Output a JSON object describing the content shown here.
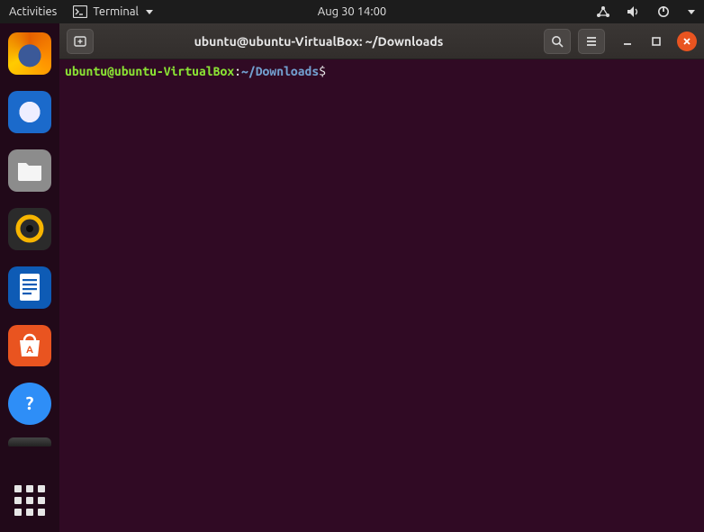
{
  "topbar": {
    "activities": "Activities",
    "app_label": "Terminal",
    "datetime": "Aug 30  14:00"
  },
  "dock": {
    "items": [
      "firefox",
      "thunderbird",
      "files",
      "rhythmbox",
      "libreoffice-writer",
      "ubuntu-software",
      "help"
    ]
  },
  "terminal": {
    "title": "ubuntu@ubuntu-VirtualBox: ~/Downloads",
    "prompt": {
      "user_host": "ubuntu@ubuntu-VirtualBox",
      "separator": ":",
      "path": "~/Downloads",
      "symbol": "$"
    },
    "input": ""
  }
}
